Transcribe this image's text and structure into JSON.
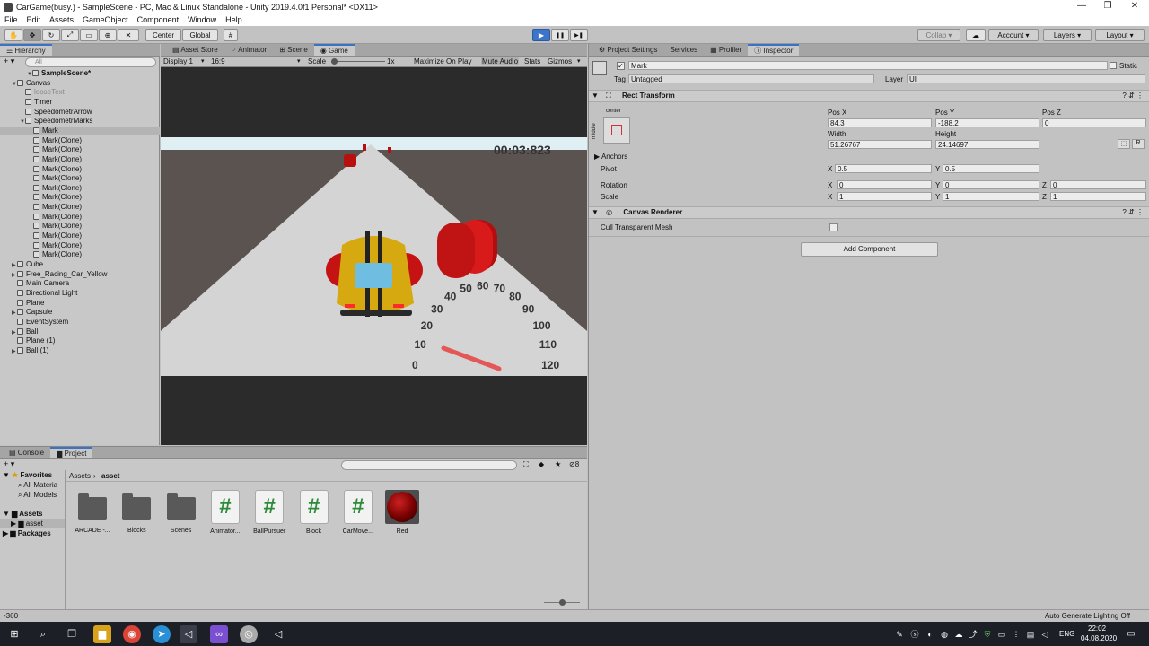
{
  "window": {
    "title": "CarGame(busy.) - SampleScene - PC, Mac & Linux Standalone - Unity 2019.4.0f1 Personal* <DX11>",
    "min": "—",
    "max": "❐",
    "close": "✕"
  },
  "menu": [
    "File",
    "Edit",
    "Assets",
    "GameObject",
    "Component",
    "Window",
    "Help"
  ],
  "toolbar": {
    "center": "Center",
    "global": "Global",
    "play": "▶",
    "pause": "❚❚",
    "step": "▶❚",
    "collab": "Collab ▾",
    "cloud": "☁",
    "account": "Account ▾",
    "layers": "Layers ▾",
    "layout": "Layout ▾"
  },
  "hierarchy": {
    "tab": "Hierarchy",
    "add": "+ ▾",
    "search_placeholder": "All",
    "items": [
      {
        "label": "SampleScene*",
        "depth": 0,
        "fold": "▼",
        "bold": true
      },
      {
        "label": "Canvas",
        "depth": 1,
        "fold": "▼"
      },
      {
        "label": "looseText",
        "depth": 2,
        "fold": "",
        "dim": true
      },
      {
        "label": "Timer",
        "depth": 2,
        "fold": ""
      },
      {
        "label": "SpeedometrArrow",
        "depth": 2,
        "fold": ""
      },
      {
        "label": "SpeedometrMarks",
        "depth": 2,
        "fold": "▼"
      },
      {
        "label": "Mark",
        "depth": 3,
        "fold": "",
        "selected": true
      },
      {
        "label": "Mark(Clone)",
        "depth": 3,
        "fold": ""
      },
      {
        "label": "Mark(Clone)",
        "depth": 3,
        "fold": ""
      },
      {
        "label": "Mark(Clone)",
        "depth": 3,
        "fold": ""
      },
      {
        "label": "Mark(Clone)",
        "depth": 3,
        "fold": ""
      },
      {
        "label": "Mark(Clone)",
        "depth": 3,
        "fold": ""
      },
      {
        "label": "Mark(Clone)",
        "depth": 3,
        "fold": ""
      },
      {
        "label": "Mark(Clone)",
        "depth": 3,
        "fold": ""
      },
      {
        "label": "Mark(Clone)",
        "depth": 3,
        "fold": ""
      },
      {
        "label": "Mark(Clone)",
        "depth": 3,
        "fold": ""
      },
      {
        "label": "Mark(Clone)",
        "depth": 3,
        "fold": ""
      },
      {
        "label": "Mark(Clone)",
        "depth": 3,
        "fold": ""
      },
      {
        "label": "Mark(Clone)",
        "depth": 3,
        "fold": ""
      },
      {
        "label": "Mark(Clone)",
        "depth": 3,
        "fold": ""
      },
      {
        "label": "Cube",
        "depth": 1,
        "fold": "▶"
      },
      {
        "label": "Free_Racing_Car_Yellow",
        "depth": 1,
        "fold": "▶"
      },
      {
        "label": "Main Camera",
        "depth": 1,
        "fold": ""
      },
      {
        "label": "Directional Light",
        "depth": 1,
        "fold": ""
      },
      {
        "label": "Plane",
        "depth": 1,
        "fold": ""
      },
      {
        "label": "Capsule",
        "depth": 1,
        "fold": "▶"
      },
      {
        "label": "EventSystem",
        "depth": 1,
        "fold": ""
      },
      {
        "label": "Ball",
        "depth": 1,
        "fold": "▶"
      },
      {
        "label": "Plane (1)",
        "depth": 1,
        "fold": ""
      },
      {
        "label": "Ball (1)",
        "depth": 1,
        "fold": "▶"
      }
    ]
  },
  "center_tabs": [
    "Asset Store",
    "Animator",
    "Scene",
    "Game"
  ],
  "game_bar": {
    "display": "Display 1",
    "aspect": "16:9",
    "scale_label": "Scale",
    "scale_value": "1x",
    "maximize": "Maximize On Play",
    "mute": "Mute Audio",
    "stats": "Stats",
    "gizmos": "Gizmos"
  },
  "game": {
    "timer": "00:03:823",
    "speedometer": [
      "0",
      "10",
      "20",
      "30",
      "40",
      "50",
      "60",
      "70",
      "80",
      "90",
      "100",
      "110",
      "120"
    ]
  },
  "inspector_tabs": [
    "Project Settings",
    "Services",
    "Profiler",
    "Inspector"
  ],
  "inspector": {
    "name": "Mark",
    "static_label": "Static",
    "tag_label": "Tag",
    "tag_value": "Untagged",
    "layer_label": "Layer",
    "layer_value": "UI",
    "rect_title": "Rect Transform",
    "anchor_top": "center",
    "anchor_side": "middle",
    "posx_label": "Pos X",
    "posx": "84.3",
    "posy_label": "Pos Y",
    "posy": "-188.2",
    "posz_label": "Pos Z",
    "posz": "0",
    "width_label": "Width",
    "width": "51.26767",
    "height_label": "Height",
    "height": "24.14697",
    "anchors_label": "Anchors",
    "pivot_label": "Pivot",
    "pivot_x": "0.5",
    "pivot_y": "0.5",
    "rotation_label": "Rotation",
    "rot_x": "0",
    "rot_y": "0",
    "rot_z": "0",
    "scale_label": "Scale",
    "scale_x": "1",
    "scale_y": "1",
    "scale_z": "1",
    "canvas_title": "Canvas Renderer",
    "cull_label": "Cull Transparent Mesh",
    "add_component": "Add Component",
    "x": "X",
    "y": "Y",
    "z": "Z",
    "r": "R"
  },
  "project": {
    "tabs": [
      "Console",
      "Project"
    ],
    "add": "+ ▾",
    "badge": "8",
    "favorites": "Favorites",
    "fav_items": [
      "All Materia",
      "All Models"
    ],
    "assets_root": "Assets",
    "asset_folder": "asset",
    "packages": "Packages",
    "breadcrumb": [
      "Assets",
      "asset"
    ],
    "items": [
      {
        "label": "ARCADE -...",
        "kind": "folder"
      },
      {
        "label": "Blocks",
        "kind": "folder"
      },
      {
        "label": "Scenes",
        "kind": "folder"
      },
      {
        "label": "Animator...",
        "kind": "script"
      },
      {
        "label": "BallPursuer",
        "kind": "script"
      },
      {
        "label": "Block",
        "kind": "script"
      },
      {
        "label": "CarMove...",
        "kind": "script"
      },
      {
        "label": "Red",
        "kind": "material"
      }
    ]
  },
  "status": {
    "left": "-360",
    "right": "Auto Generate Lighting Off"
  },
  "taskbar": {
    "lang": "ENG",
    "time": "22:02",
    "date": "04.08.2020"
  }
}
